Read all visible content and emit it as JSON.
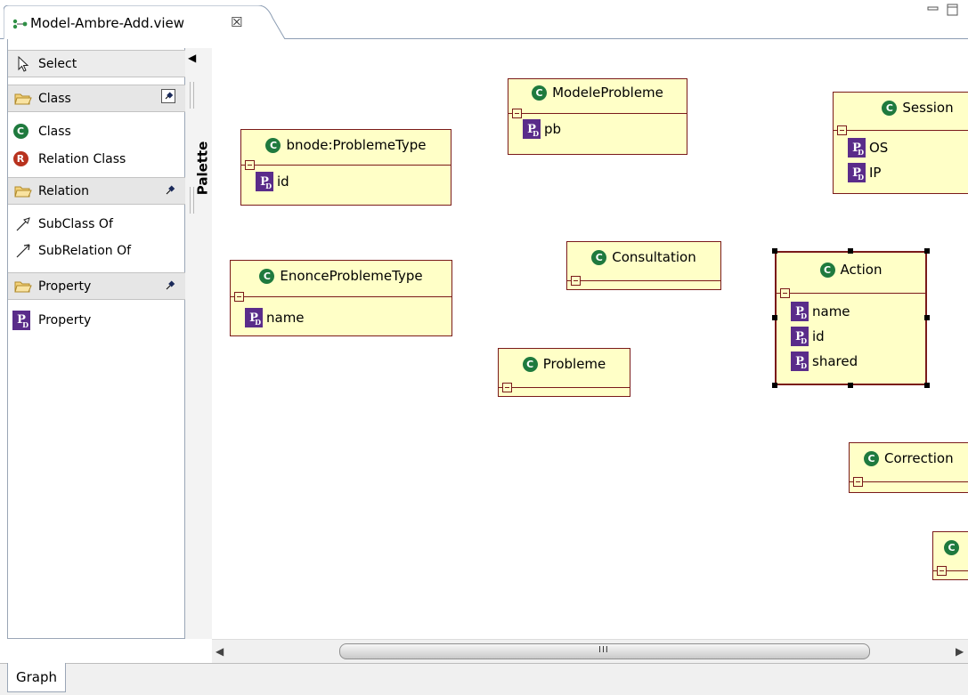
{
  "editor": {
    "tab_title": "Model-Ambre-Add.view",
    "tab_close": "☒",
    "bottom_tab": "Graph"
  },
  "palette": {
    "label": "Palette",
    "select": "Select",
    "drawers": [
      {
        "label": "Class"
      },
      {
        "label": "Relation"
      },
      {
        "label": "Property"
      }
    ],
    "tools": {
      "class": "Class",
      "relation_class": "Relation Class",
      "subclass_of": "SubClass Of",
      "subrelation_of": "SubRelation  Of",
      "property": "Property"
    }
  },
  "canvas": {
    "nodes": {
      "bnode": {
        "name": "bnode:ProblemeType",
        "attrs": [
          "id"
        ]
      },
      "modele": {
        "name": "ModeleProbleme",
        "attrs": [
          "pb"
        ]
      },
      "session": {
        "name": "Session",
        "attrs": [
          "OS",
          "IP"
        ]
      },
      "enonce": {
        "name": "EnonceProblemeType",
        "attrs": [
          "name"
        ]
      },
      "consultation": {
        "name": "Consultation",
        "attrs": []
      },
      "action": {
        "name": "Action",
        "attrs": [
          "name",
          "id",
          "shared"
        ]
      },
      "probleme": {
        "name": "Probleme",
        "attrs": []
      },
      "correction": {
        "name": "Correction",
        "attrs": []
      },
      "partial": {
        "name": "",
        "attrs": []
      }
    },
    "icon_letters": {
      "class": "C",
      "relation": "R",
      "property": "P",
      "property_sub": "D"
    }
  },
  "scrollbar": {
    "grip": "III"
  },
  "colors": {
    "node_fill": "#ffffc7",
    "node_border": "#7a1a1a",
    "class_icon": "#1f7a3e",
    "property_icon": "#5a2c8a"
  }
}
